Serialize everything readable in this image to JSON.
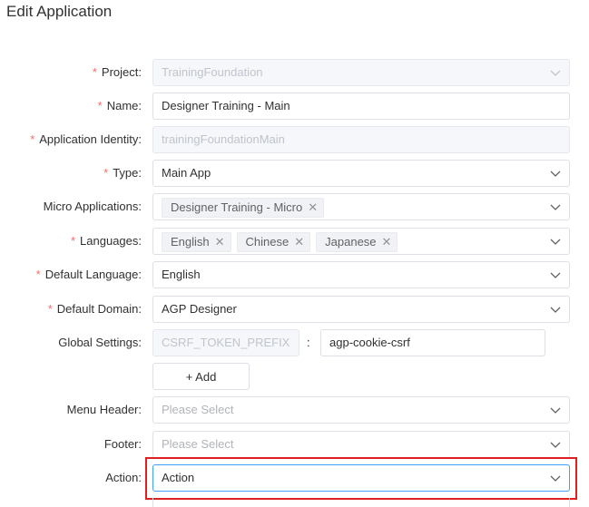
{
  "page": {
    "title": "Edit Application"
  },
  "form": {
    "project": {
      "label": "Project:",
      "required": true,
      "value": "TrainingFoundation",
      "disabled": true
    },
    "name": {
      "label": "Name:",
      "required": true,
      "value": "Designer Training - Main"
    },
    "identity": {
      "label": "Application Identity:",
      "required": true,
      "value": "trainingFoundationMain",
      "disabled": true
    },
    "type": {
      "label": "Type:",
      "required": true,
      "value": "Main App"
    },
    "micro": {
      "label": "Micro Applications:",
      "required": false,
      "tags": [
        "Designer Training - Micro"
      ]
    },
    "languages": {
      "label": "Languages:",
      "required": true,
      "tags": [
        "English",
        "Chinese",
        "Japanese"
      ]
    },
    "default_language": {
      "label": "Default Language:",
      "required": true,
      "value": "English"
    },
    "default_domain": {
      "label": "Default Domain:",
      "required": true,
      "value": "AGP Designer"
    },
    "global_settings": {
      "label": "Global Settings:",
      "key": "CSRF_TOKEN_PREFIX",
      "separator": ":",
      "value": "agp-cookie-csrf"
    },
    "add_button": "+ Add",
    "menu_header": {
      "label": "Menu Header:",
      "placeholder": "Please Select"
    },
    "footer": {
      "label": "Footer:",
      "placeholder": "Please Select"
    },
    "action": {
      "label": "Action:",
      "value": "Action"
    }
  },
  "icons": {
    "dropdown": "chevron-down-icon",
    "tag_close": "close-icon"
  },
  "colors": {
    "required": "#f56c6c",
    "highlight": "#e02020",
    "focus": "#409eff"
  }
}
